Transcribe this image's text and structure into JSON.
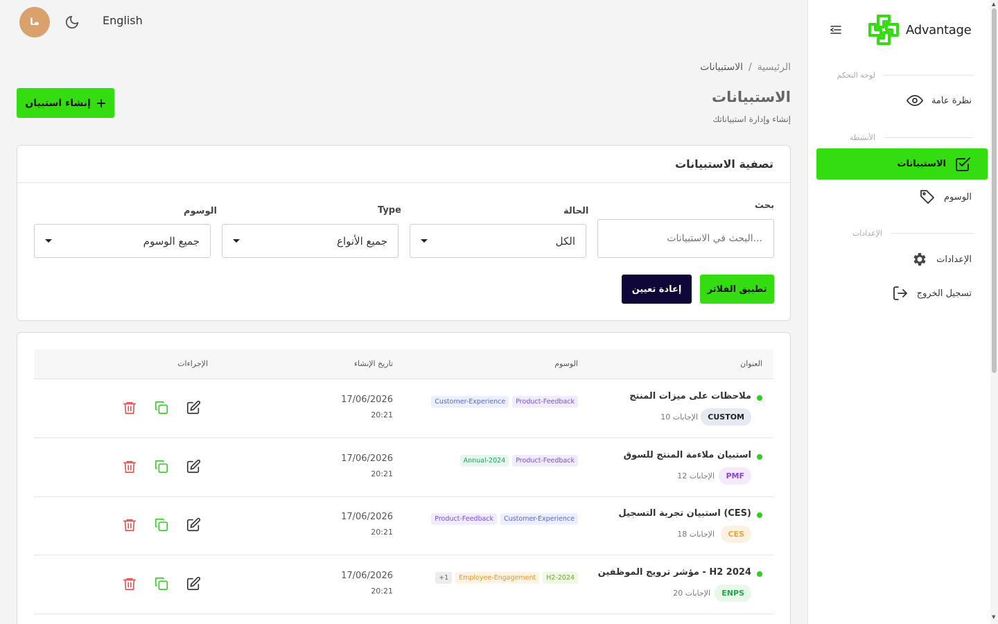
{
  "header": {
    "avatar_initials": "ما",
    "language": "English"
  },
  "sidebar": {
    "logo_text": "Advantage",
    "sections": {
      "dashboard": "لوحة التحكم",
      "activities": "الأنشطة",
      "settings": "الإعدادات"
    },
    "items": {
      "overview": "نظرة عامة",
      "surveys": "الاستبيانات",
      "tags": "الوسوم",
      "settings": "الإعدادات",
      "logout": "تسجيل الخروج"
    }
  },
  "breadcrumb": {
    "home": "الرئيسية",
    "separator": "/",
    "current": "الاستبيانات"
  },
  "page": {
    "title": "الاستبيانات",
    "subtitle": "إنشاء وإدارة استبياناتك",
    "create_button": "إنشاء استبيان"
  },
  "filters": {
    "title": "تصفية الاستبيانات",
    "search_label": "بحث",
    "search_placeholder": "البحث في الاستبيانات...",
    "status_label": "الحالة",
    "status_value": "الكل",
    "type_label": "Type",
    "type_value": "جميع الأنواع",
    "tags_label": "الوسوم",
    "tags_value": "جميع الوسوم",
    "apply": "تطبيق الفلاتر",
    "reset": "إعادة تعيين"
  },
  "table": {
    "columns": {
      "title": "العنوان",
      "tags": "الوسوم",
      "created": "تاريخ الإنشاء",
      "actions": "الإجراءات"
    },
    "rows": [
      {
        "title": "ملاحظات على ميزات المنتج",
        "type": "CUSTOM",
        "responses": "10 الإجابات",
        "tags": [
          "Product-Feedback",
          "Customer-Experience"
        ],
        "date": "17/06/2026",
        "time": "20:21"
      },
      {
        "title": "استبيان ملاءمة المنتج للسوق",
        "type": "PMF",
        "responses": "12 الإجابات",
        "tags": [
          "Product-Feedback",
          "Annual-2024"
        ],
        "date": "17/06/2026",
        "time": "20:21"
      },
      {
        "title": "استبيان تجربة التسجيل (CES)",
        "type": "CES",
        "responses": "18 الإجابات",
        "tags": [
          "Customer-Experience",
          "Product-Feedback"
        ],
        "date": "17/06/2026",
        "time": "20:21"
      },
      {
        "title": "مؤشر ترويج الموظفين - H2 2024",
        "type": "ENPS",
        "responses": "20 الإجابات",
        "tags": [
          "H2-2024",
          "Employee-Engagement",
          "1+"
        ],
        "date": "17/06/2026",
        "time": "20:21"
      }
    ]
  },
  "colors": {
    "accent": "#33dd0f",
    "dark_button": "#0e0738",
    "delete": "#e05555",
    "copy": "#33cc22"
  },
  "icons": {
    "menu": "menu-collapse-icon",
    "moon": "moon-icon",
    "eye": "eye-icon",
    "check": "checkbox-icon",
    "tag": "tag-icon",
    "gear": "gear-icon",
    "logout": "logout-icon",
    "plus": "plus-icon",
    "edit": "edit-icon",
    "copy": "copy-icon",
    "trash": "trash-icon"
  }
}
